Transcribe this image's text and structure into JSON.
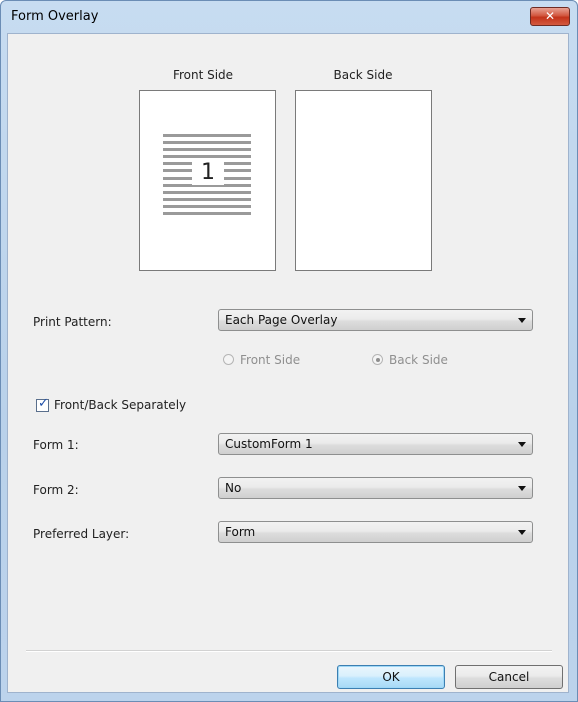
{
  "window": {
    "title": "Form Overlay",
    "close_icon": "close-icon"
  },
  "preview": {
    "front_label": "Front Side",
    "back_label": "Back Side",
    "front_page_number": "1"
  },
  "print_pattern": {
    "label": "Print Pattern:",
    "value": "Each Page Overlay"
  },
  "radios": {
    "front": {
      "label": "Front Side",
      "selected": false,
      "enabled": false
    },
    "back": {
      "label": "Back Side",
      "selected": true,
      "enabled": false
    }
  },
  "separately": {
    "label": "Front/Back Separately",
    "checked": true
  },
  "form1": {
    "label": "Form 1:",
    "value": "CustomForm 1"
  },
  "form2": {
    "label": "Form 2:",
    "value": "No"
  },
  "preferred_layer": {
    "label": "Preferred Layer:",
    "value": "Form"
  },
  "buttons": {
    "ok": "OK",
    "cancel": "Cancel"
  }
}
